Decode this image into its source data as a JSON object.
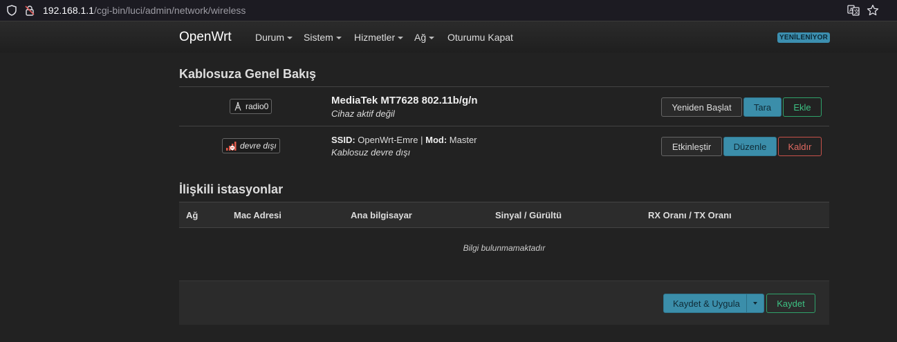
{
  "browser": {
    "url_host": "192.168.1.1",
    "url_path": "/cgi-bin/luci/admin/network/wireless"
  },
  "navbar": {
    "brand": "OpenWrt",
    "items": [
      {
        "label": "Durum"
      },
      {
        "label": "Sistem"
      },
      {
        "label": "Hizmetler"
      },
      {
        "label": "Ağ"
      },
      {
        "label": "Oturumu Kapat"
      }
    ],
    "badge": "YENİLENİYOR"
  },
  "overview": {
    "title": "Kablosuza Genel Bakış",
    "device": {
      "tag": "radio0",
      "name": "MediaTek MT7628 802.11b/g/n",
      "status": "Cihaz aktif değil",
      "restart_label": "Yeniden Başlat",
      "scan_label": "Tara",
      "add_label": "Ekle"
    },
    "network": {
      "tag": "devre dışı",
      "ssid_key": "SSID:",
      "ssid_value": "OpenWrt-Emre",
      "separator": "|",
      "mode_key": "Mod:",
      "mode_value": "Master",
      "status": "Kablosuz devre dışı",
      "enable_label": "Etkinleştir",
      "edit_label": "Düzenle",
      "remove_label": "Kaldır"
    }
  },
  "stations": {
    "title": "İlişkili istasyonlar",
    "columns": [
      "Ağ",
      "Mac Adresi",
      "Ana bilgisayar",
      "Sinyal / Gürültü",
      "RX Oranı / TX Oranı"
    ],
    "empty_text": "Bilgi bulunmamaktadır"
  },
  "footer": {
    "save_apply_label": "Kaydet & Uygula",
    "save_label": "Kaydet"
  },
  "colors": {
    "primary": "#3b8eaa",
    "positive": "#2fa36b",
    "negative": "#c9524b"
  }
}
